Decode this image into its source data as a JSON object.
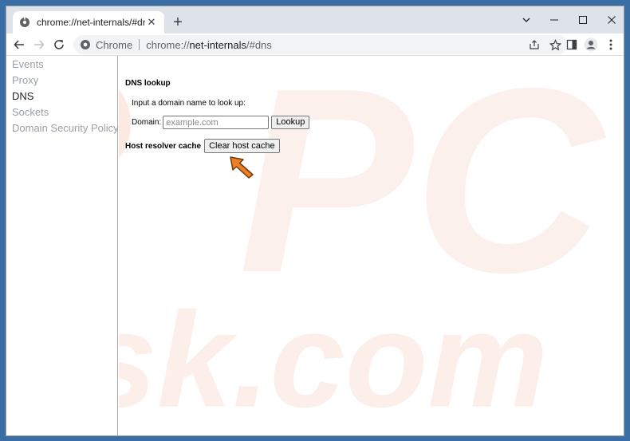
{
  "tab": {
    "title": "chrome://net-internals/#dns",
    "close": "✕",
    "new": "+"
  },
  "toolbar": {
    "site_name": "Chrome",
    "url_scheme": "chrome://",
    "url_host": "net-internals",
    "url_path": "/#dns"
  },
  "sidebar": {
    "items": [
      {
        "label": "Events"
      },
      {
        "label": "Proxy"
      },
      {
        "label": "DNS"
      },
      {
        "label": "Sockets"
      },
      {
        "label": "Domain Security Policy"
      }
    ],
    "active": "DNS"
  },
  "dns": {
    "title": "DNS lookup",
    "prompt": "Input a domain name to look up:",
    "domain_label": "Domain:",
    "domain_placeholder": "example.com",
    "domain_value": "",
    "lookup_label": "Lookup",
    "cache_label": "Host resolver cache",
    "clear_label": "Clear host cache"
  },
  "watermark": {
    "top": "PC",
    "bottom": "risk.com"
  },
  "icons": {
    "favicon": "chrome-settings-icon",
    "pointer": "orange-arrow-pointer-icon"
  },
  "colors": {
    "desktop": "#3a6ea5",
    "tabstrip": "#dee3ea",
    "pointer": "#f07e22",
    "watermark": "#fbe9e2"
  }
}
